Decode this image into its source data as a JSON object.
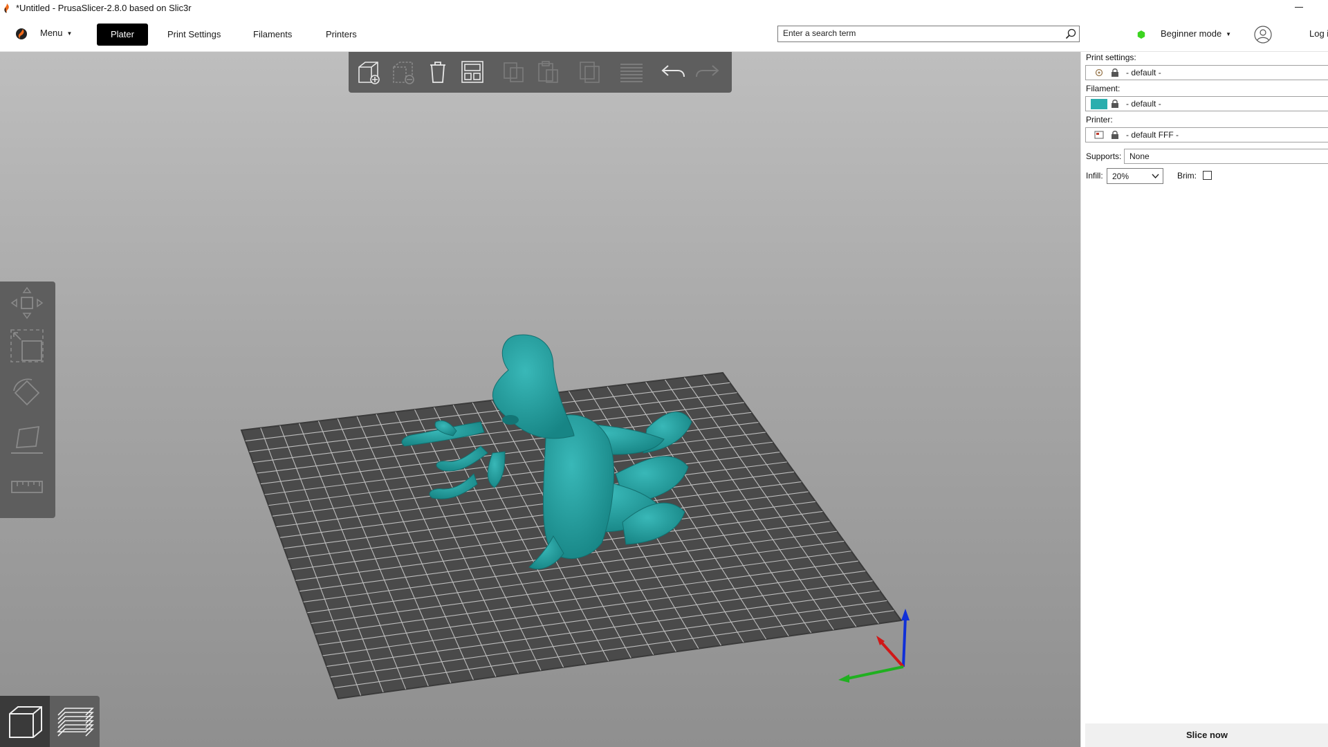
{
  "window": {
    "title": "*Untitled - PrusaSlicer-2.8.0 based on Slic3r"
  },
  "topnav": {
    "menu_label": "Menu",
    "tabs": [
      {
        "label": "Plater",
        "active": true
      },
      {
        "label": "Print Settings",
        "active": false
      },
      {
        "label": "Filaments",
        "active": false
      },
      {
        "label": "Printers",
        "active": false
      }
    ],
    "search_placeholder": "Enter a search term",
    "mode_label": "Beginner mode",
    "mode_color": "#3cd420",
    "login_label": "Log in"
  },
  "toolbar": {
    "buttons": [
      "add-object",
      "delete-object",
      "delete-all",
      "arrange",
      "copy",
      "paste",
      "add-instance",
      "variable-layer-height",
      "undo",
      "redo"
    ]
  },
  "left_toolbar": {
    "tools": [
      "move",
      "scale",
      "rotate",
      "place-on-face",
      "measure"
    ]
  },
  "view_toggle": {
    "modes": [
      "3d-view",
      "preview"
    ],
    "active": "3d-view"
  },
  "sidebar": {
    "print_settings_label": "Print settings:",
    "print_settings_value": "- default -",
    "filament_label": "Filament:",
    "filament_value": "- default -",
    "filament_color": "#2aaeae",
    "printer_label": "Printer:",
    "printer_value": "- default FFF -",
    "supports_label": "Supports:",
    "supports_value": "None",
    "infill_label": "Infill:",
    "infill_value": "20%",
    "brim_label": "Brim:",
    "brim_checked": false,
    "slice_label": "Slice now"
  },
  "colors": {
    "model": "#1f9b9b",
    "bed": "#4a4a4a",
    "toolbar_bg": "#5e5e5e"
  }
}
